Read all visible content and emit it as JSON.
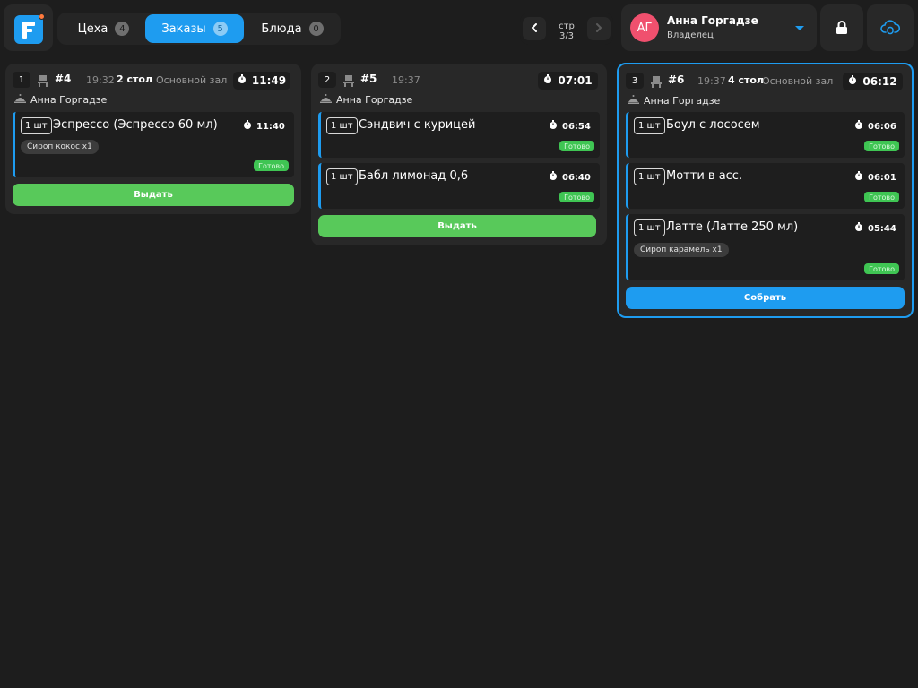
{
  "header": {
    "tabs": [
      {
        "label": "Цеха",
        "count": "4",
        "active": false
      },
      {
        "label": "Заказы",
        "count": "5",
        "active": true
      },
      {
        "label": "Блюда",
        "count": "0",
        "active": false
      }
    ],
    "pager": {
      "label": "стр 3/3"
    },
    "user": {
      "initials": "АГ",
      "name": "Анна Горгадзе",
      "role": "Владелец"
    }
  },
  "colors": {
    "accent": "#1e9cf0",
    "ready": "#3fc553",
    "button_green": "#58c95a",
    "avatar": "#f0506e"
  },
  "orders": [
    {
      "index": "1",
      "number": "#4",
      "time": "19:32",
      "table": "2 стол",
      "hall": "Основной зал",
      "timer": "11:49",
      "waiter": "Анна Горгадзе",
      "items": [
        {
          "qty": "1 шт",
          "name": "Эспрессо (Эспрессо 60 мл)",
          "timer": "11:40",
          "modifier": "Сироп кокос x1",
          "status": "Готово"
        }
      ],
      "action": "Выдать"
    },
    {
      "index": "2",
      "number": "#5",
      "time": "19:37",
      "table": "",
      "hall": "",
      "timer": "07:01",
      "waiter": "Анна Горгадзе",
      "items": [
        {
          "qty": "1 шт",
          "name": "Сэндвич с курицей",
          "timer": "06:54",
          "status": "Готово"
        },
        {
          "qty": "1 шт",
          "name": "Бабл лимонад 0,6",
          "timer": "06:40",
          "status": "Готово"
        }
      ],
      "action": "Выдать"
    },
    {
      "index": "3",
      "number": "#6",
      "time": "19:37",
      "table": "4 стол",
      "hall": "Основной зал",
      "timer": "06:12",
      "waiter": "Анна Горгадзе",
      "items": [
        {
          "qty": "1 шт",
          "name": "Боул с лососем",
          "timer": "06:06",
          "status": "Готово"
        },
        {
          "qty": "1 шт",
          "name": "Мотти в асс.",
          "timer": "06:01",
          "status": "Готово"
        },
        {
          "qty": "1 шт",
          "name": "Латте (Латте 250 мл)",
          "timer": "05:44",
          "modifier": "Сироп карамель x1",
          "status": "Готово"
        }
      ],
      "action": "Собрать"
    }
  ]
}
